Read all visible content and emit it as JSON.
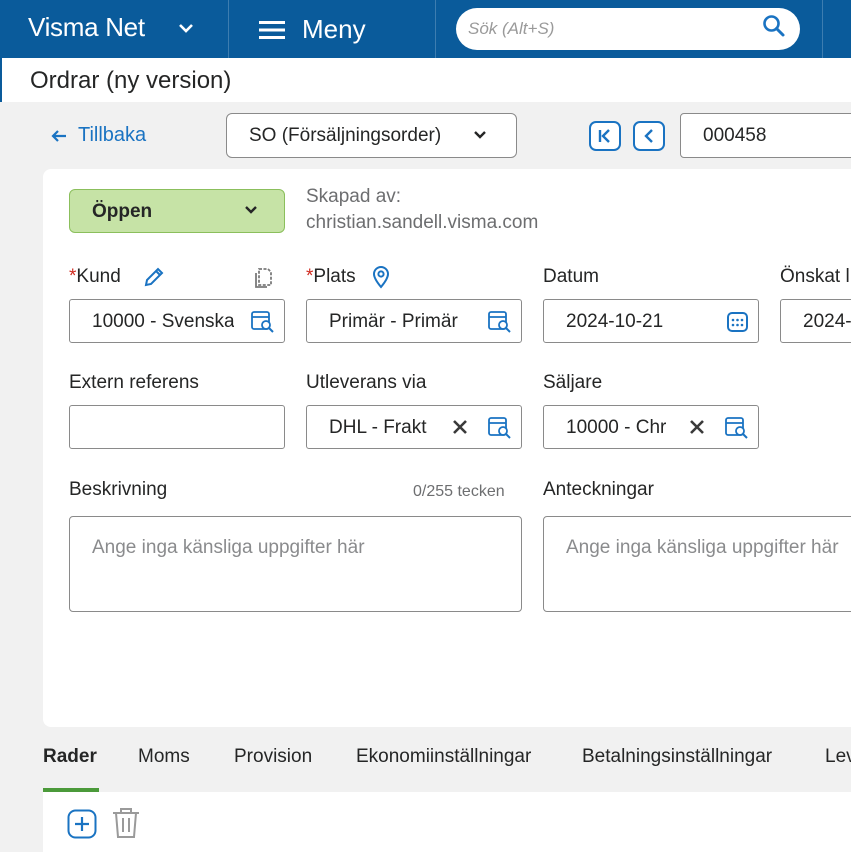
{
  "topbar": {
    "brand": "Visma Net",
    "menu_label": "Meny",
    "search_placeholder": "Sök (Alt+S)"
  },
  "page": {
    "title": "Ordrar (ny version)"
  },
  "toolbar": {
    "back_label": "Tillbaka",
    "order_type": "SO (Försäljningsorder)",
    "order_number": "000458"
  },
  "form": {
    "status": "Öppen",
    "created_by_label": "Skapad av:",
    "created_by_value": "christian.sandell.visma.com",
    "customer": {
      "label": "Kund",
      "value": "10000 - Svenska",
      "required": "*"
    },
    "location": {
      "label": "Plats",
      "value": "Primär - Primär",
      "required": "*"
    },
    "date": {
      "label": "Datum",
      "value": "2024-10-21"
    },
    "requested": {
      "label": "Önskat l",
      "value": "2024-"
    },
    "external_ref": {
      "label": "Extern referens",
      "value": ""
    },
    "ship_via": {
      "label": "Utleverans via",
      "value": "DHL - Frakt"
    },
    "salesperson": {
      "label": "Säljare",
      "value": "10000 - Chr"
    },
    "description": {
      "label": "Beskrivning",
      "counter": "0/255 tecken",
      "placeholder": "Ange inga känsliga uppgifter här"
    },
    "notes": {
      "label": "Anteckningar",
      "placeholder": "Ange inga känsliga uppgifter här"
    }
  },
  "tabs": [
    "Rader",
    "Moms",
    "Provision",
    "Ekonomiinställningar",
    "Betalningsinställningar",
    "Lev"
  ],
  "colors": {
    "header": "#0a5b9b",
    "accent": "#1a73c2",
    "status_green": "#c6e3a6",
    "active_tab_underline": "#4b9a3a",
    "required": "#d02b20"
  }
}
